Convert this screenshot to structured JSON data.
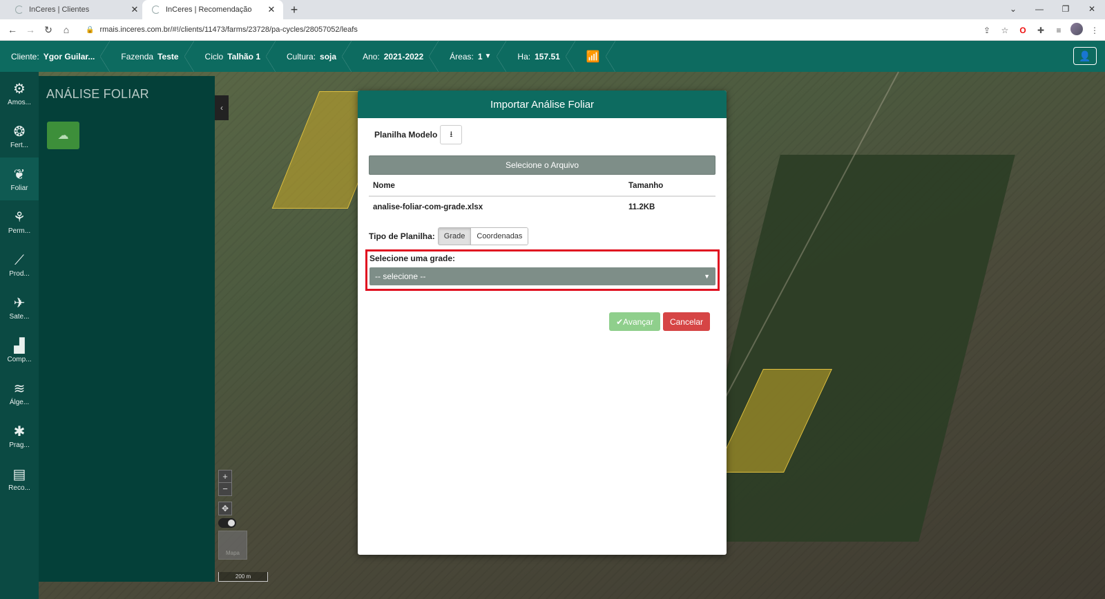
{
  "browser": {
    "tabs": [
      {
        "title": "InCeres | Clientes"
      },
      {
        "title": "InCeres | Recomendação"
      }
    ],
    "url": "rmais.inceres.com.br/#!/clients/11473/farms/23728/pa-cycles/28057052/leafs"
  },
  "header": {
    "crumbs": [
      {
        "label": "Cliente:",
        "value": "Ygor Guilar..."
      },
      {
        "label": "Fazenda",
        "value": "Teste"
      },
      {
        "label": "Ciclo",
        "value": "Talhão 1"
      },
      {
        "label": "Cultura:",
        "value": "soja"
      },
      {
        "label": "Ano:",
        "value": "2021-2022"
      },
      {
        "label": "Áreas:",
        "value": "1"
      },
      {
        "label": "Ha:",
        "value": "157.51"
      }
    ]
  },
  "sidebar": {
    "items": [
      {
        "label": "Amos...",
        "icon": "sampling-icon"
      },
      {
        "label": "Fert...",
        "icon": "fertility-icon"
      },
      {
        "label": "Foliar",
        "icon": "leaf-icon"
      },
      {
        "label": "Perm...",
        "icon": "permission-icon"
      },
      {
        "label": "Prod...",
        "icon": "productivity-icon"
      },
      {
        "label": "Sate...",
        "icon": "satellite-icon"
      },
      {
        "label": "Comp...",
        "icon": "compaction-icon"
      },
      {
        "label": "Álge...",
        "icon": "layers-icon"
      },
      {
        "label": "Prag...",
        "icon": "bug-icon"
      },
      {
        "label": "Reco...",
        "icon": "recommendation-icon"
      }
    ]
  },
  "panel": {
    "title": "ANÁLISE FOLIAR"
  },
  "map": {
    "thumb_label": "Mapa",
    "scale": "200 m"
  },
  "modal": {
    "title": "Importar Análise Foliar",
    "planilha_label": "Planilha Modelo",
    "select_file_label": "Selecione o Arquivo",
    "table": {
      "headers": [
        "Nome",
        "Tamanho"
      ],
      "rows": [
        {
          "name": "analise-foliar-com-grade.xlsx",
          "size": "11.2KB"
        }
      ]
    },
    "tipo_label": "Tipo de Planilha:",
    "tipo_options": [
      "Grade",
      "Coordenadas"
    ],
    "tipo_selected": "Grade",
    "grade_label": "Selecione uma grade:",
    "grade_select_value": "-- selecione --",
    "avancar_label": "Avançar",
    "cancelar_label": "Cancelar"
  },
  "colors": {
    "header": "#0d6b60",
    "highlight": "#e01020",
    "avancar": "#8fcf8c",
    "cancelar": "#d64545"
  }
}
